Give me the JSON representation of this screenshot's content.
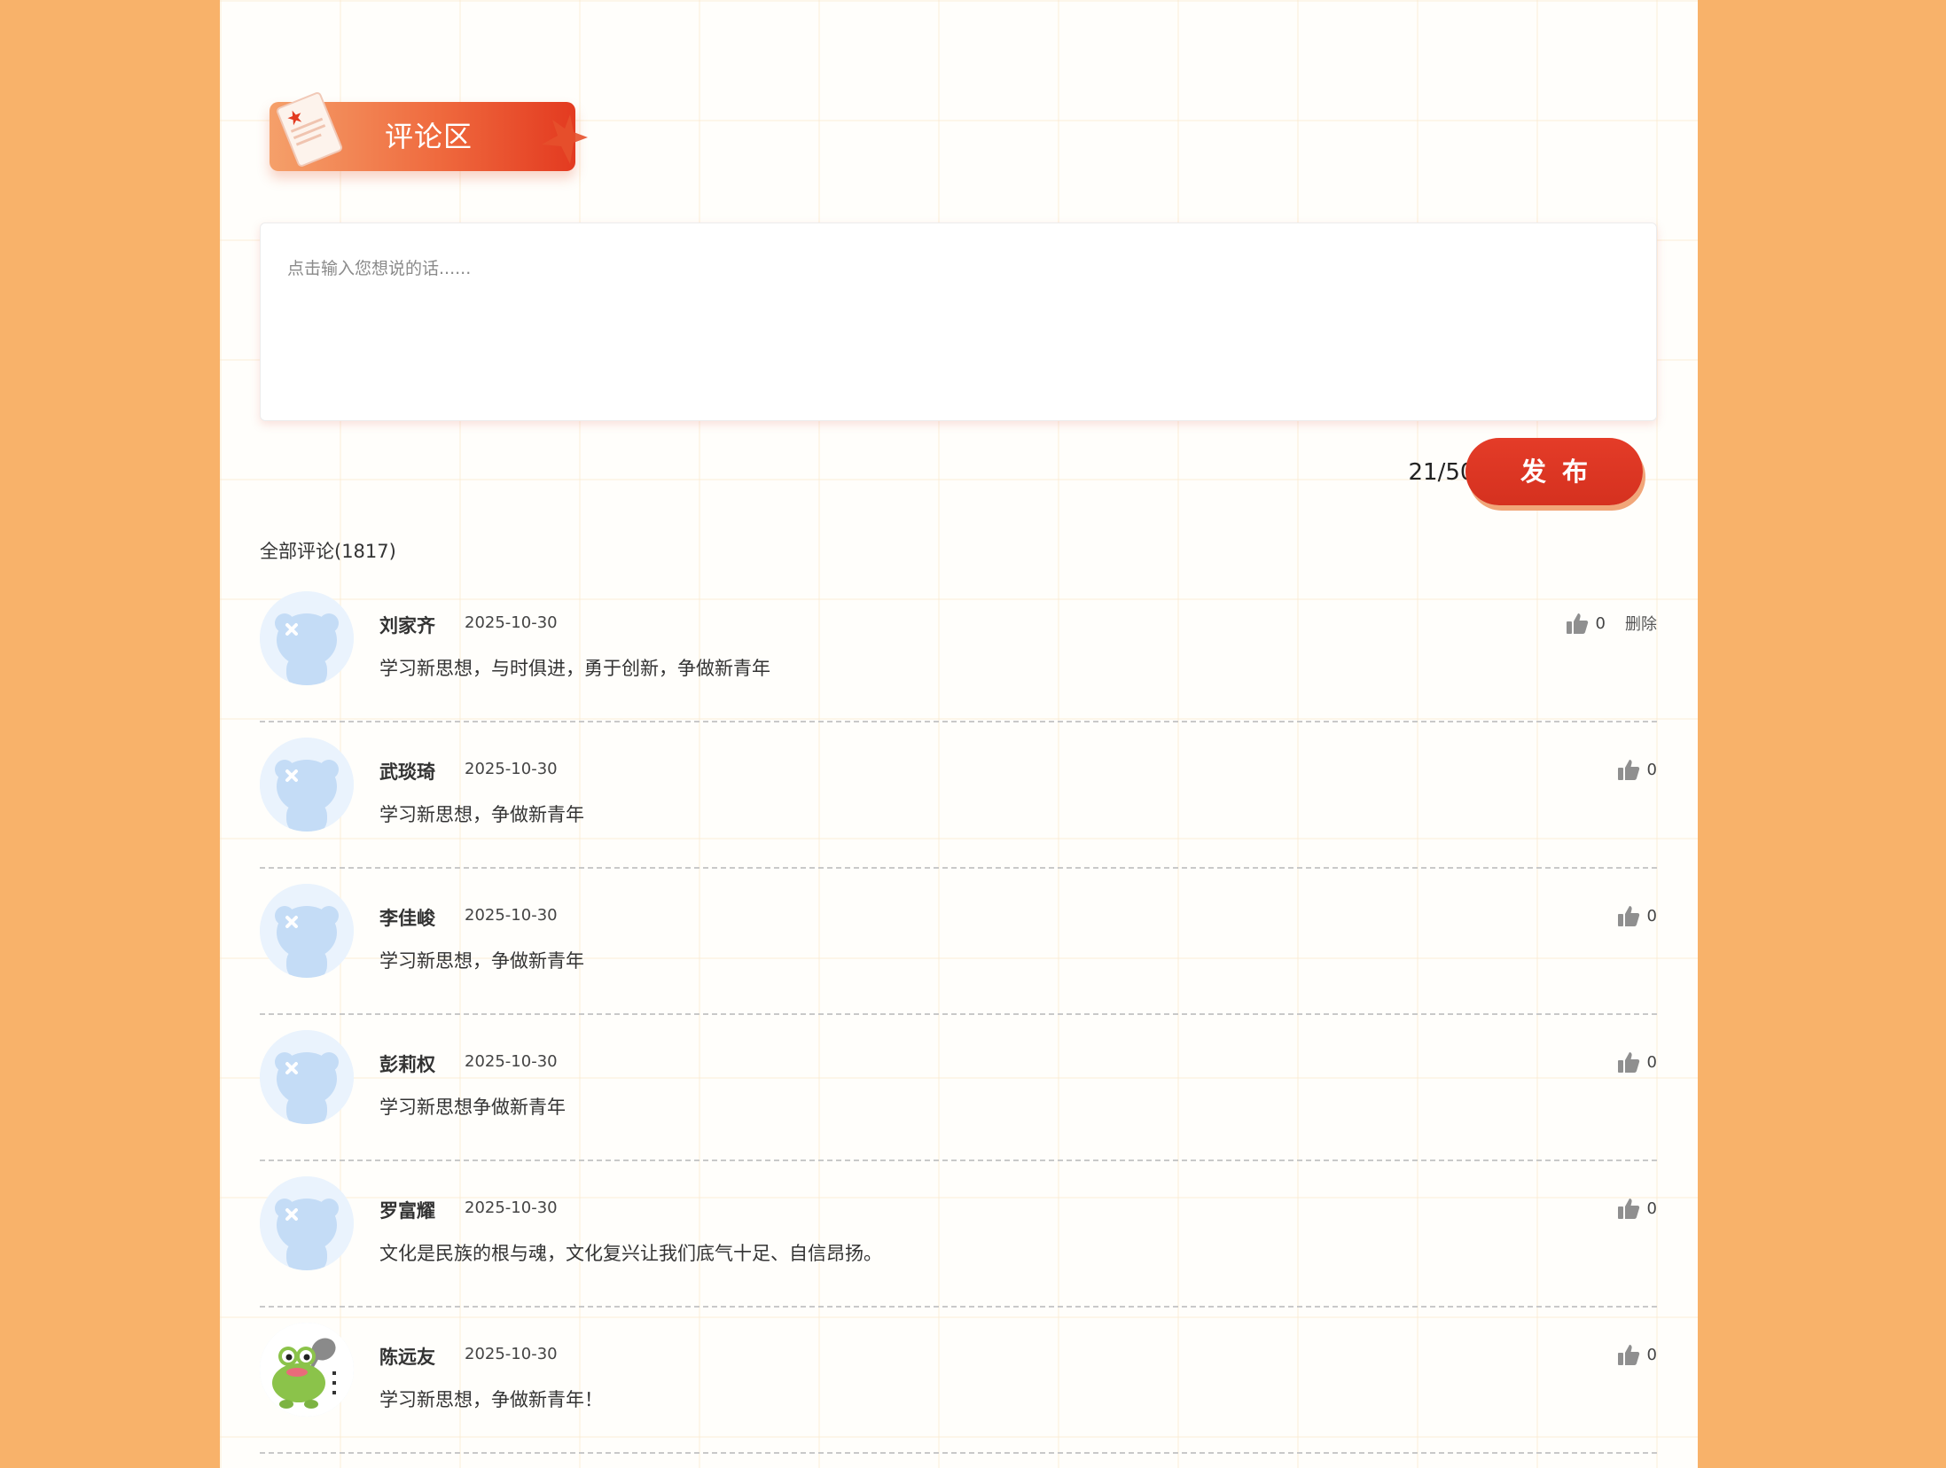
{
  "banner": {
    "title": "评论区"
  },
  "comment_input": {
    "placeholder": "点击输入您想说的话......",
    "char_count": "21/500",
    "publish_label": "发布"
  },
  "list": {
    "title": "全部评论(1817)"
  },
  "colors": {
    "accent": "#d5311f",
    "page_background": "#f8b26a"
  },
  "comments": [
    {
      "name": "刘家齐",
      "date": "2025-10-30",
      "text": "学习新思想，与时俱进，勇于创新，争做新青年",
      "likes": "0",
      "delete_label": "删除",
      "avatar": "default-avatar"
    },
    {
      "name": "武琰琦",
      "date": "2025-10-30",
      "text": "学习新思想，争做新青年",
      "likes": "0",
      "avatar": "default-avatar"
    },
    {
      "name": "李佳峻",
      "date": "2025-10-30",
      "text": "学习新思想，争做新青年",
      "likes": "0",
      "avatar": "default-avatar"
    },
    {
      "name": "彭莉权",
      "date": "2025-10-30",
      "text": "学习新思想争做新青年",
      "likes": "0",
      "avatar": "default-avatar"
    },
    {
      "name": "罗富耀",
      "date": "2025-10-30",
      "text": "文化是民族的根与魂，文化复兴让我们底气十足、自信昂扬。",
      "likes": "0",
      "avatar": "default-avatar"
    },
    {
      "name": "陈远友",
      "date": "2025-10-30",
      "text": "学习新思想，争做新青年！",
      "likes": "0",
      "avatar": "frog-avatar"
    }
  ]
}
